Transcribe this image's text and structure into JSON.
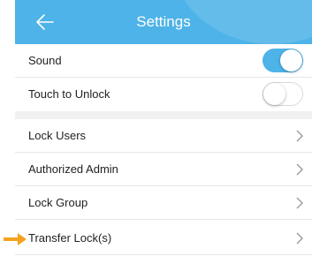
{
  "header": {
    "title": "Settings",
    "back_icon": "arrow-left-icon",
    "color": "#4db3e8"
  },
  "settings": {
    "toggles": [
      {
        "label": "Sound",
        "state": "on"
      },
      {
        "label": "Touch to Unlock",
        "state": "off"
      }
    ],
    "nav_items": [
      {
        "label": "Lock Users",
        "icon": "chevron-right-icon"
      },
      {
        "label": "Authorized Admin",
        "icon": "chevron-right-icon"
      },
      {
        "label": "Lock Group",
        "icon": "chevron-right-icon"
      },
      {
        "label": "Transfer Lock(s)",
        "icon": "chevron-right-icon"
      }
    ]
  },
  "annotation": {
    "pointer_icon": "arrow-right-icon",
    "pointer_color": "#f5a21f"
  }
}
